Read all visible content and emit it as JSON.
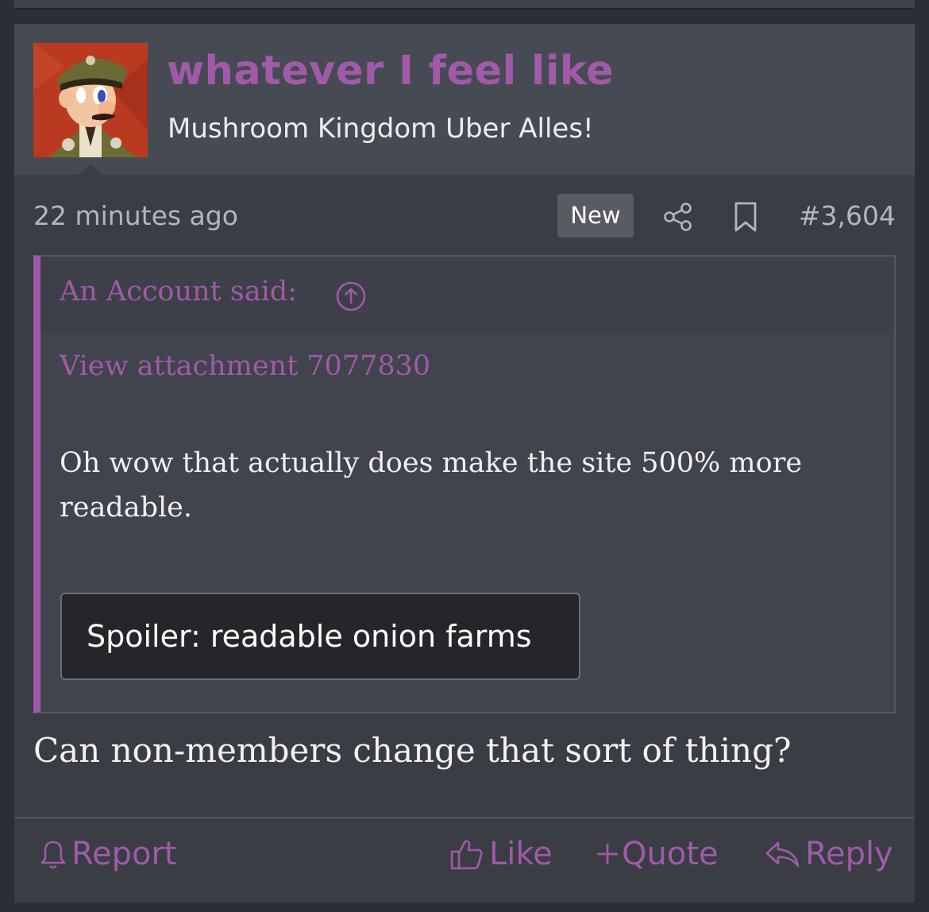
{
  "post": {
    "username": "whatever I feel like",
    "user_title": "Mushroom Kingdom Uber Alles!",
    "timestamp": "22 minutes ago",
    "new_badge": "New",
    "post_number": "#3,604",
    "body": "Can non-members change that sort of thing?"
  },
  "quote": {
    "author_line": "An Account said:",
    "attachment_link": "View attachment 7077830",
    "text": "Oh wow that actually does make the site 500% more readable.",
    "spoiler_label": "Spoiler: readable onion farms"
  },
  "actions": {
    "report": "Report",
    "like": "Like",
    "quote": "Quote",
    "reply": "Reply"
  },
  "colors": {
    "accent": "#a05aa8",
    "post_background": "#3a3d44",
    "header_background": "#464a52",
    "page_background": "#2b2e34"
  },
  "icons": {
    "share": "share-icon",
    "bookmark": "bookmark-icon",
    "quote_jump": "arrow-up-circle-icon",
    "report": "bell-icon",
    "like": "thumbs-up-icon",
    "quote": "plus-icon",
    "reply": "reply-arrow-icon"
  }
}
